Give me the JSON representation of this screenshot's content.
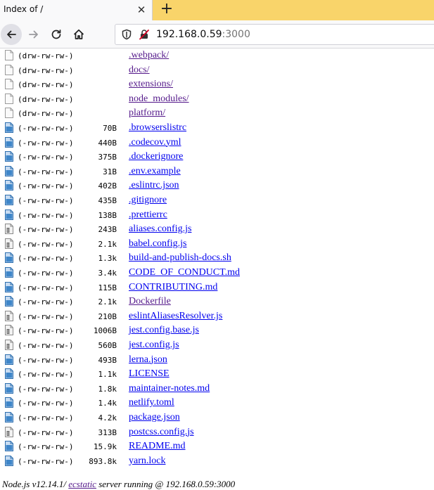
{
  "tab": {
    "title": "Index of /",
    "close_glyph": "✕",
    "new_tab_glyph": "+"
  },
  "navbar": {
    "back_icon": "arrow-left-icon",
    "forward_icon": "arrow-right-icon",
    "reload_icon": "reload-icon",
    "home_icon": "home-icon",
    "url_host": "192.168.0.59",
    "url_port": ":3000"
  },
  "entries": [
    {
      "perm": "(drw-rw-rw-)",
      "size": "",
      "name": ".webpack/",
      "type": "dir"
    },
    {
      "perm": "(drw-rw-rw-)",
      "size": "",
      "name": "docs/",
      "type": "dir"
    },
    {
      "perm": "(drw-rw-rw-)",
      "size": "",
      "name": "extensions/",
      "type": "dir"
    },
    {
      "perm": "(drw-rw-rw-)",
      "size": "",
      "name": "node_modules/",
      "type": "dir"
    },
    {
      "perm": "(drw-rw-rw-)",
      "size": "",
      "name": "platform/",
      "type": "dir"
    },
    {
      "perm": "(-rw-rw-rw-)",
      "size": "70B",
      "name": ".browserslistrc",
      "type": "file"
    },
    {
      "perm": "(-rw-rw-rw-)",
      "size": "440B",
      "name": ".codecov.yml",
      "type": "file"
    },
    {
      "perm": "(-rw-rw-rw-)",
      "size": "375B",
      "name": ".dockerignore",
      "type": "file"
    },
    {
      "perm": "(-rw-rw-rw-)",
      "size": "31B",
      "name": ".env.example",
      "type": "file"
    },
    {
      "perm": "(-rw-rw-rw-)",
      "size": "402B",
      "name": ".eslintrc.json",
      "type": "file"
    },
    {
      "perm": "(-rw-rw-rw-)",
      "size": "435B",
      "name": ".gitignore",
      "type": "file"
    },
    {
      "perm": "(-rw-rw-rw-)",
      "size": "138B",
      "name": ".prettierrc",
      "type": "file"
    },
    {
      "perm": "(-rw-rw-rw-)",
      "size": "243B",
      "name": "aliases.config.js",
      "type": "script"
    },
    {
      "perm": "(-rw-rw-rw-)",
      "size": "2.1k",
      "name": "babel.config.js",
      "type": "script"
    },
    {
      "perm": "(-rw-rw-rw-)",
      "size": "1.3k",
      "name": "build-and-publish-docs.sh",
      "type": "file"
    },
    {
      "perm": "(-rw-rw-rw-)",
      "size": "3.4k",
      "name": "CODE_OF_CONDUCT.md",
      "type": "file"
    },
    {
      "perm": "(-rw-rw-rw-)",
      "size": "115B",
      "name": "CONTRIBUTING.md",
      "type": "file"
    },
    {
      "perm": "(-rw-rw-rw-)",
      "size": "2.1k",
      "name": "Dockerfile",
      "type": "file"
    },
    {
      "perm": "(-rw-rw-rw-)",
      "size": "210B",
      "name": "eslintAliasesResolver.js",
      "type": "script"
    },
    {
      "perm": "(-rw-rw-rw-)",
      "size": "1006B",
      "name": "jest.config.base.js",
      "type": "script"
    },
    {
      "perm": "(-rw-rw-rw-)",
      "size": "560B",
      "name": "jest.config.js",
      "type": "script"
    },
    {
      "perm": "(-rw-rw-rw-)",
      "size": "493B",
      "name": "lerna.json",
      "type": "file"
    },
    {
      "perm": "(-rw-rw-rw-)",
      "size": "1.1k",
      "name": "LICENSE",
      "type": "file"
    },
    {
      "perm": "(-rw-rw-rw-)",
      "size": "1.8k",
      "name": "maintainer-notes.md",
      "type": "file"
    },
    {
      "perm": "(-rw-rw-rw-)",
      "size": "1.4k",
      "name": "netlify.toml",
      "type": "file"
    },
    {
      "perm": "(-rw-rw-rw-)",
      "size": "4.2k",
      "name": "package.json",
      "type": "file"
    },
    {
      "perm": "(-rw-rw-rw-)",
      "size": "313B",
      "name": "postcss.config.js",
      "type": "script"
    },
    {
      "perm": "(-rw-rw-rw-)",
      "size": "15.9k",
      "name": "README.md",
      "type": "file"
    },
    {
      "perm": "(-rw-rw-rw-)",
      "size": "893.8k",
      "name": "yarn.lock",
      "type": "file"
    }
  ],
  "footer": {
    "prefix": "Node.js v12.14.1/ ",
    "link": "ecstatic",
    "suffix": " server running @ 192.168.0.59:3000"
  }
}
